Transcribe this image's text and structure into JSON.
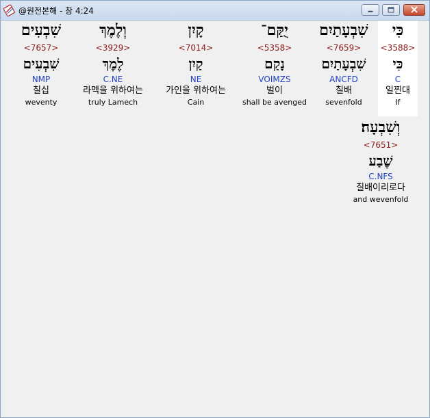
{
  "window": {
    "title": "@원전본해 - 창 4:24",
    "icon": "bible-app-icon"
  },
  "words": [
    {
      "hebrew": "כִּי",
      "strong": "<3588>",
      "lemma": "כִּי",
      "morph": "C",
      "korean": "일찐대",
      "english": "If",
      "highlighted": true
    },
    {
      "hebrew": "שִׁבְעָתַיִם",
      "strong": "<7659>",
      "lemma": "שִׁבְעָתַיִם",
      "morph": "ANCFD",
      "korean": "칠배",
      "english": "sevenfold"
    },
    {
      "hebrew": "יֻקַּם־",
      "strong": "<5358>",
      "lemma": "נָקַם",
      "morph": "VOIMZS",
      "korean": "벌이",
      "english": "shall be avenged"
    },
    {
      "hebrew": "קָיִן",
      "strong": "<7014>",
      "lemma": "קַיִן",
      "morph": "NE",
      "korean": "가인을 위하여는",
      "english": "Cain"
    },
    {
      "hebrew": "וְלֶמֶךְ",
      "strong": "<3929>",
      "lemma": "לֶמֶךְ",
      "morph": "C.NE",
      "korean": "라멕을 위하여는",
      "english": "truly Lamech"
    },
    {
      "hebrew": "שִׁבְעִים",
      "strong": "<7657>",
      "lemma": "שִׁבְעִים",
      "morph": "NMP",
      "korean": "칠십",
      "english": "weventy"
    },
    {
      "hebrew": "וְשִׁבְעָה׃",
      "strong": "<7651>",
      "lemma": "שֶׁבַע",
      "morph": "C.NFS",
      "korean": "칠배이리로다",
      "english": "and wevenfold"
    }
  ]
}
